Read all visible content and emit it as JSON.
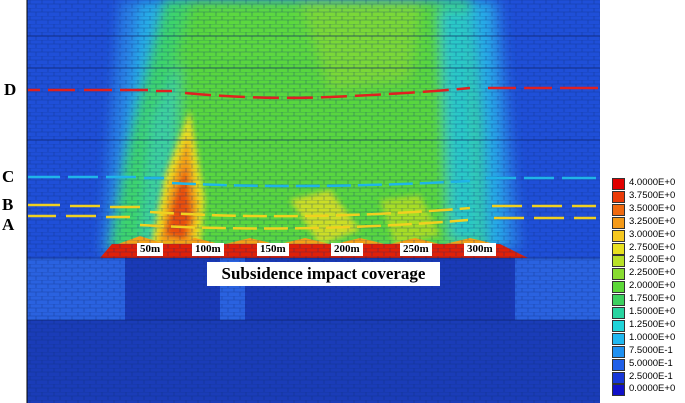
{
  "layer_labels": [
    {
      "name": "D",
      "color": "#d82020"
    },
    {
      "name": "C",
      "color": "#1ab0e0"
    },
    {
      "name": "B",
      "color": "#f0d020"
    },
    {
      "name": "A",
      "color": "#f0d020"
    }
  ],
  "distance_markers": [
    "50m",
    "100m",
    "150m",
    "200m",
    "250m",
    "300m"
  ],
  "coverage_label": "Subsidence impact coverage",
  "legend": {
    "items": [
      {
        "value": "4.0000E+0",
        "color": "#e00000"
      },
      {
        "value": "3.7500E+0",
        "color": "#ea3a08"
      },
      {
        "value": "3.5000E+0",
        "color": "#f06a10"
      },
      {
        "value": "3.2500E+0",
        "color": "#f49a18"
      },
      {
        "value": "3.0000E+0",
        "color": "#f6c820"
      },
      {
        "value": "2.7500E+0",
        "color": "#e8e020"
      },
      {
        "value": "2.5000E+0",
        "color": "#b8e028"
      },
      {
        "value": "2.2500E+0",
        "color": "#88dc30"
      },
      {
        "value": "2.0000E+0",
        "color": "#5cd838"
      },
      {
        "value": "1.7500E+0",
        "color": "#3cd060"
      },
      {
        "value": "1.5000E+0",
        "color": "#28d4a0"
      },
      {
        "value": "1.2500E+0",
        "color": "#20d4d8"
      },
      {
        "value": "1.0000E+0",
        "color": "#20b8f0"
      },
      {
        "value": "7.5000E-1",
        "color": "#2090f0"
      },
      {
        "value": "5.0000E-1",
        "color": "#2060e8"
      },
      {
        "value": "2.5000E-1",
        "color": "#1838d8"
      },
      {
        "value": "0.0000E+0",
        "color": "#1010c8"
      }
    ]
  }
}
